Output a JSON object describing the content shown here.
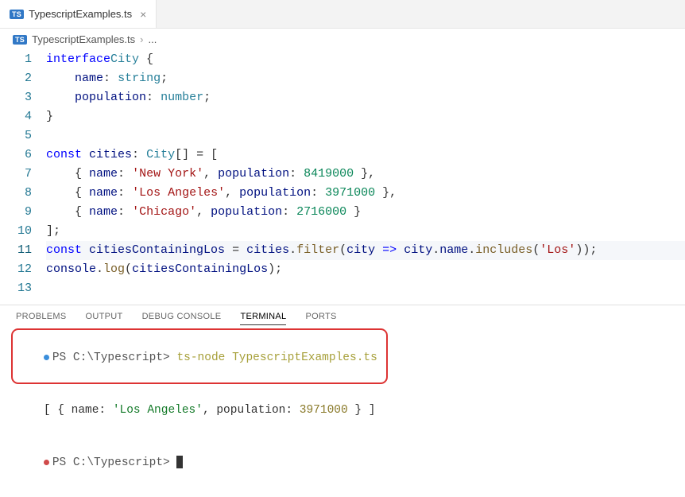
{
  "tab": {
    "badge": "TS",
    "filename": "TypescriptExamples.ts",
    "close": "×"
  },
  "breadcrumb": {
    "badge": "TS",
    "file": "TypescriptExamples.ts",
    "chev": "›",
    "rest": "..."
  },
  "code": {
    "lines": [
      {
        "n": "1",
        "seg": [
          [
            "kw",
            "interface"
          ],
          [
            "",
            ""
          ],
          [
            "type",
            "City"
          ],
          [
            "",
            " {"
          ]
        ]
      },
      {
        "n": "2",
        "seg": [
          [
            "",
            "    "
          ],
          [
            "prop",
            "name"
          ],
          [
            "punct",
            ":"
          ],
          [
            "",
            " "
          ],
          [
            "type",
            "string"
          ],
          [
            "punct",
            ";"
          ]
        ]
      },
      {
        "n": "3",
        "seg": [
          [
            "",
            "    "
          ],
          [
            "prop",
            "population"
          ],
          [
            "punct",
            ":"
          ],
          [
            "",
            " "
          ],
          [
            "type",
            "number"
          ],
          [
            "punct",
            ";"
          ]
        ]
      },
      {
        "n": "4",
        "seg": [
          [
            "",
            "}"
          ]
        ]
      },
      {
        "n": "5",
        "seg": [
          [
            "",
            ""
          ]
        ]
      },
      {
        "n": "6",
        "seg": [
          [
            "kw",
            "const"
          ],
          [
            "",
            " "
          ],
          [
            "ident",
            "cities"
          ],
          [
            "punct",
            ":"
          ],
          [
            "",
            " "
          ],
          [
            "type",
            "City"
          ],
          [
            "punct",
            "[] = ["
          ]
        ]
      },
      {
        "n": "7",
        "seg": [
          [
            "",
            "    { "
          ],
          [
            "prop",
            "name"
          ],
          [
            "punct",
            ":"
          ],
          [
            "",
            " "
          ],
          [
            "str",
            "'New York'"
          ],
          [
            "punct",
            ", "
          ],
          [
            "prop",
            "population"
          ],
          [
            "punct",
            ":"
          ],
          [
            "",
            " "
          ],
          [
            "num",
            "8419000"
          ],
          [
            "",
            " },"
          ]
        ]
      },
      {
        "n": "8",
        "seg": [
          [
            "",
            "    { "
          ],
          [
            "prop",
            "name"
          ],
          [
            "punct",
            ":"
          ],
          [
            "",
            " "
          ],
          [
            "str",
            "'Los Angeles'"
          ],
          [
            "punct",
            ", "
          ],
          [
            "prop",
            "population"
          ],
          [
            "punct",
            ":"
          ],
          [
            "",
            " "
          ],
          [
            "num",
            "3971000"
          ],
          [
            "",
            " },"
          ]
        ]
      },
      {
        "n": "9",
        "seg": [
          [
            "",
            "    { "
          ],
          [
            "prop",
            "name"
          ],
          [
            "punct",
            ":"
          ],
          [
            "",
            " "
          ],
          [
            "str",
            "'Chicago'"
          ],
          [
            "punct",
            ", "
          ],
          [
            "prop",
            "population"
          ],
          [
            "punct",
            ":"
          ],
          [
            "",
            " "
          ],
          [
            "num",
            "2716000"
          ],
          [
            "",
            " }"
          ]
        ]
      },
      {
        "n": "10",
        "seg": [
          [
            "",
            "];"
          ]
        ]
      },
      {
        "n": "11",
        "hl": true,
        "seg": [
          [
            "kw",
            "const"
          ],
          [
            "",
            " "
          ],
          [
            "ident",
            "citiesContainingLos"
          ],
          [
            "",
            " = "
          ],
          [
            "ident",
            "cities"
          ],
          [
            "punct",
            "."
          ],
          [
            "fn",
            "filter"
          ],
          [
            "punct",
            "("
          ],
          [
            "ident",
            "city"
          ],
          [
            "",
            " "
          ],
          [
            "kw",
            "=>"
          ],
          [
            "",
            " "
          ],
          [
            "ident",
            "city"
          ],
          [
            "punct",
            "."
          ],
          [
            "ident",
            "name"
          ],
          [
            "punct",
            "."
          ],
          [
            "fn",
            "includes"
          ],
          [
            "punct",
            "("
          ],
          [
            "str",
            "'Los'"
          ],
          [
            "punct",
            "));"
          ]
        ]
      },
      {
        "n": "12",
        "seg": [
          [
            "ident",
            "console"
          ],
          [
            "punct",
            "."
          ],
          [
            "fn",
            "log"
          ],
          [
            "punct",
            "("
          ],
          [
            "ident",
            "citiesContainingLos"
          ],
          [
            "punct",
            ");"
          ]
        ]
      },
      {
        "n": "13",
        "seg": [
          [
            "",
            ""
          ]
        ]
      }
    ]
  },
  "panel": {
    "tabs": [
      "PROBLEMS",
      "OUTPUT",
      "DEBUG CONSOLE",
      "TERMINAL",
      "PORTS"
    ],
    "active": 3
  },
  "terminal": {
    "line1": {
      "prompt": "PS C:\\Typescript> ",
      "cmd": "ts-node TypescriptExamples.ts"
    },
    "line2": {
      "pre": "[ { name: ",
      "str": "'Los Angeles'",
      "mid": ", population: ",
      "num": "3971000",
      "post": " } ]"
    },
    "line3": {
      "prompt": "PS C:\\Typescript> "
    }
  }
}
